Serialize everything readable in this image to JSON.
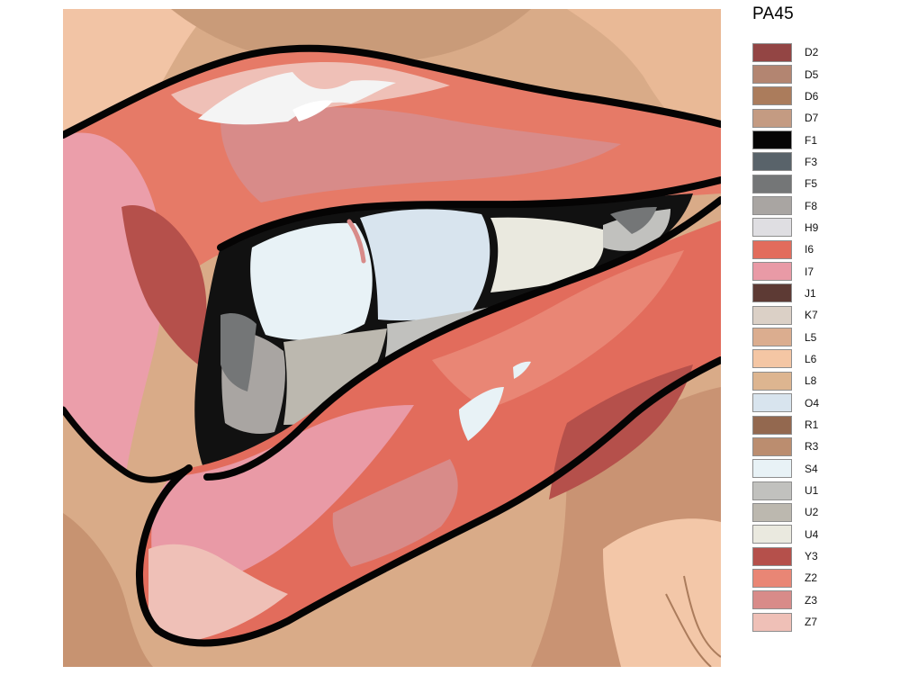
{
  "product_code": "PA45",
  "palette_colors": [
    {
      "code": "D2",
      "color": "#934544"
    },
    {
      "code": "D5",
      "color": "#b38571"
    },
    {
      "code": "D6",
      "color": "#ab7c5c"
    },
    {
      "code": "D7",
      "color": "#c49b82"
    },
    {
      "code": "F1",
      "color": "#050404"
    },
    {
      "code": "F3",
      "color": "#59636a"
    },
    {
      "code": "F5",
      "color": "#747677"
    },
    {
      "code": "F8",
      "color": "#a9a5a2"
    },
    {
      "code": "H9",
      "color": "#dfdee2"
    },
    {
      "code": "I6",
      "color": "#e26c5c"
    },
    {
      "code": "I7",
      "color": "#e99aa6"
    },
    {
      "code": "J1",
      "color": "#5d3a34"
    },
    {
      "code": "K7",
      "color": "#dbd0c6"
    },
    {
      "code": "L5",
      "color": "#dbad8f"
    },
    {
      "code": "L6",
      "color": "#f4c6a4"
    },
    {
      "code": "L8",
      "color": "#ddb590"
    },
    {
      "code": "O4",
      "color": "#d8e4ee"
    },
    {
      "code": "R1",
      "color": "#93684f"
    },
    {
      "code": "R3",
      "color": "#bb8d6f"
    },
    {
      "code": "S4",
      "color": "#e8f2f6"
    },
    {
      "code": "U1",
      "color": "#c1c1be"
    },
    {
      "code": "U2",
      "color": "#bcb8af"
    },
    {
      "code": "U4",
      "color": "#eae9df"
    },
    {
      "code": "Y3",
      "color": "#b5504b"
    },
    {
      "code": "Z2",
      "color": "#e98675"
    },
    {
      "code": "Z3",
      "color": "#d88b89"
    },
    {
      "code": "Z7",
      "color": "#efc0b7"
    }
  ]
}
